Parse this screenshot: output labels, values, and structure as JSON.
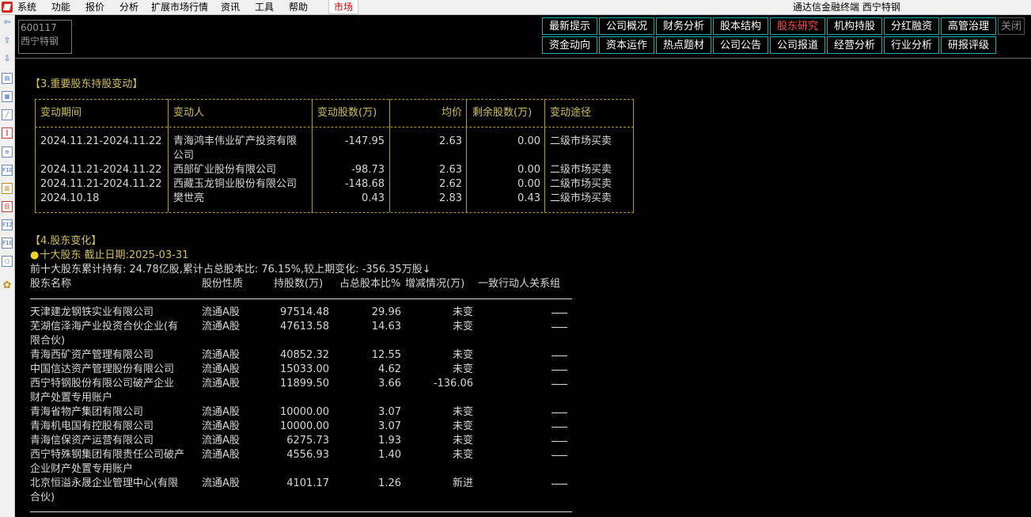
{
  "menubar": {
    "items": [
      "系统",
      "功能",
      "报价",
      "分析",
      "扩展市场行情",
      "资讯",
      "工具",
      "帮助"
    ],
    "market": "市场",
    "app_title": "通达信金融终端 西宁特钢"
  },
  "stock": {
    "code": "600117",
    "name": "西宁特钢"
  },
  "topnav": {
    "row1": [
      "最新提示",
      "公司概况",
      "财务分析",
      "股本结构",
      "股东研究",
      "机构持股",
      "分红融资",
      "高管治理"
    ],
    "row2": [
      "资金动向",
      "资本运作",
      "热点题材",
      "公司公告",
      "公司报道",
      "经营分析",
      "行业分析",
      "研报评级"
    ],
    "close": "关闭",
    "active": "股东研究"
  },
  "sidebar_icons": [
    "arrow-left-icon",
    "arrow-up-icon",
    "arrow-down-icon",
    "quote-list-icon",
    "grid-table-icon",
    "line-chart-icon",
    "candlestick-icon",
    "news-icon",
    "f10-icon",
    "report-icon",
    "ledger-icon",
    "f12-icon",
    "f10-alt-icon",
    "circle-icon",
    "gear-icon"
  ],
  "section3": {
    "title": "【3.重要股东持股变动】",
    "headers": [
      "变动期间",
      "变动人",
      "变动股数(万)",
      "均价",
      "剩余股数(万)",
      "变动途径"
    ],
    "rows": [
      {
        "period": "2024.11.21-2024.11.22",
        "person1": "青海鸿丰伟业矿产投资有限",
        "person2": "公司",
        "shares": "-147.95",
        "price": "2.63",
        "remain": "0.00",
        "way": "二级市场买卖"
      },
      {
        "period": "2024.11.21-2024.11.22",
        "person1": "西部矿业股份有限公司",
        "shares": "-98.73",
        "price": "2.63",
        "remain": "0.00",
        "way": "二级市场买卖"
      },
      {
        "period": "2024.11.21-2024.11.22",
        "person1": "西藏玉龙铜业股份有限公司",
        "shares": "-148.68",
        "price": "2.62",
        "remain": "0.00",
        "way": "二级市场买卖"
      },
      {
        "period": "2024.10.18",
        "person1": "樊世亮",
        "shares": "0.43",
        "price": "2.83",
        "remain": "0.43",
        "way": "二级市场买卖"
      }
    ]
  },
  "section4": {
    "title": "【4.股东变化】",
    "subtitle": "十大股东 截止日期:2025-03-31",
    "summary": "前十大股东累计持有: 24.78亿股,累计占总股本比: 76.15%,较上期变化: -356.35万股↓",
    "headers": [
      "股东名称",
      "股份性质",
      "持股数(万)",
      "占总股本比%",
      "增减情况(万)",
      "一致行动人关系组"
    ],
    "rows": [
      {
        "name1": "天津建龙钢铁实业有限公司",
        "type": "流通A股",
        "shares": "97514.48",
        "ratio": "29.96",
        "change": "未变"
      },
      {
        "name1": "芜湖信泽海产业投资合伙企业(有",
        "name2": "限合伙)",
        "type": "流通A股",
        "shares": "47613.58",
        "ratio": "14.63",
        "change": "未变"
      },
      {
        "name1": "青海西矿资产管理有限公司",
        "type": "流通A股",
        "shares": "40852.32",
        "ratio": "12.55",
        "change": "未变"
      },
      {
        "name1": "中国信达资产管理股份有限公司",
        "type": "流通A股",
        "shares": "15033.00",
        "ratio": "4.62",
        "change": "未变"
      },
      {
        "name1": "西宁特钢股份有限公司破产企业",
        "name2": "财产处置专用账户",
        "type": "流通A股",
        "shares": "11899.50",
        "ratio": "3.66",
        "change": "-136.06"
      },
      {
        "name1": "青海省物产集团有限公司",
        "type": "流通A股",
        "shares": "10000.00",
        "ratio": "3.07",
        "change": "未变"
      },
      {
        "name1": "青海机电国有控股有限公司",
        "type": "流通A股",
        "shares": "10000.00",
        "ratio": "3.07",
        "change": "未变"
      },
      {
        "name1": "青海信保资产运营有限公司",
        "type": "流通A股",
        "shares": "6275.73",
        "ratio": "1.93",
        "change": "未变"
      },
      {
        "name1": "西宁特殊钢集团有限责任公司破产",
        "name2": "企业财产处置专用账户",
        "type": "流通A股",
        "shares": "4556.93",
        "ratio": "1.40",
        "change": "未变"
      },
      {
        "name1": "北京恒溢永晟企业管理中心(有限",
        "name2": "合伙)",
        "type": "流通A股",
        "shares": "4101.17",
        "ratio": "1.26",
        "change": "新进"
      }
    ]
  }
}
